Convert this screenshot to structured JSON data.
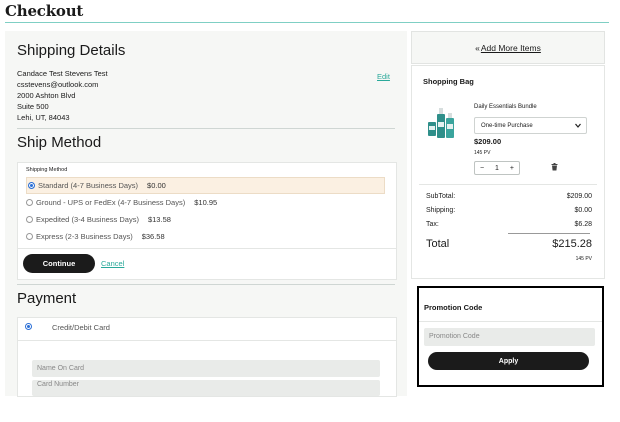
{
  "page": {
    "title": "Checkout"
  },
  "shipping_details": {
    "heading": "Shipping Details",
    "edit_label": "Edit",
    "address_lines": [
      "Candace Test Stevens Test",
      "csstevens@outlook.com",
      "2000 Ashton Blvd",
      "Suite 500",
      "Lehi, UT, 84043"
    ]
  },
  "ship_method": {
    "heading": "Ship Method",
    "field_label": "Shipping Method",
    "options": [
      {
        "label": "Standard (4-7 Business Days)",
        "price": "$0.00",
        "selected": true
      },
      {
        "label": "Ground - UPS or FedEx (4-7 Business Days)",
        "price": "$10.95",
        "selected": false
      },
      {
        "label": "Expedited (3-4 Business Days)",
        "price": "$13.58",
        "selected": false
      },
      {
        "label": "Express (2-3 Business Days)",
        "price": "$36.58",
        "selected": false
      }
    ],
    "continue_label": "Continue",
    "cancel_label": "Cancel"
  },
  "payment": {
    "heading": "Payment",
    "method_label": "Credit/Debit Card",
    "name_placeholder": "Name On Card",
    "card_number_label": "Card Number"
  },
  "sidebar": {
    "add_more_icon": "«",
    "add_more_label": "Add More Items",
    "bag": {
      "title": "Shopping Bag",
      "item": {
        "name": "Daily Essentials Bundle",
        "purchase_type": "One-time Purchase",
        "price": "$209.00",
        "pv": "145 PV",
        "qty": "1",
        "minus": "−",
        "plus": "+"
      },
      "summary": {
        "subtotal_label": "SubTotal:",
        "subtotal": "$209.00",
        "shipping_label": "Shipping:",
        "shipping": "$0.00",
        "tax_label": "Tax:",
        "tax": "$6.28",
        "total_label": "Total",
        "total": "$215.28",
        "total_pv": "145 PV"
      }
    },
    "promo": {
      "title": "Promotion Code",
      "placeholder": "Promotion Code",
      "apply_label": "Apply"
    }
  },
  "colors": {
    "accent": "#2aa99a",
    "dark_button": "#1b1b1b",
    "selected_option_bg": "#fbf0e2"
  }
}
